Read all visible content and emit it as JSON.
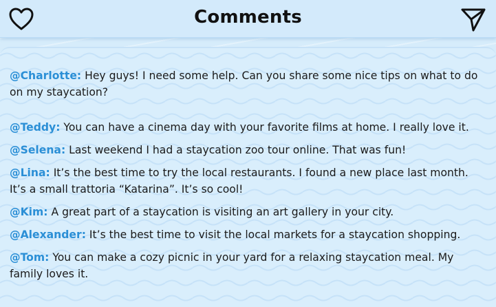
{
  "header": {
    "title": "Comments",
    "like_icon": "heart-icon",
    "send_icon": "send-icon"
  },
  "colors": {
    "background": "#d9eefc",
    "username": "#2b8fd6",
    "text": "#1a1a1a"
  },
  "comments": [
    {
      "user": "@Charlotte:",
      "text": " Hey guys! I need some help. Can you share some nice tips on what to do on my staycation?"
    },
    {
      "user": "@Teddy:",
      "text": " You can have a cinema day with your favorite films at home. I really love it."
    },
    {
      "user": "@Selena:",
      "text": " Last weekend I had a staycation zoo tour online. That was fun!"
    },
    {
      "user": "@Lina:",
      "text": " It’s the best time to try the local restaurants. I found a new place last month. It’s a small trattoria “Katarina”. It’s so cool!"
    },
    {
      "user": "@Kim:",
      "text": " A great part of a staycation is visiting an art gallery in your city."
    },
    {
      "user": "@Alexander:",
      "text": " It’s the best time to visit the local markets for a staycation shopping."
    },
    {
      "user": "@Tom:",
      "text": " You can make a cozy picnic in your yard for a relaxing staycation meal. My family loves it."
    }
  ]
}
